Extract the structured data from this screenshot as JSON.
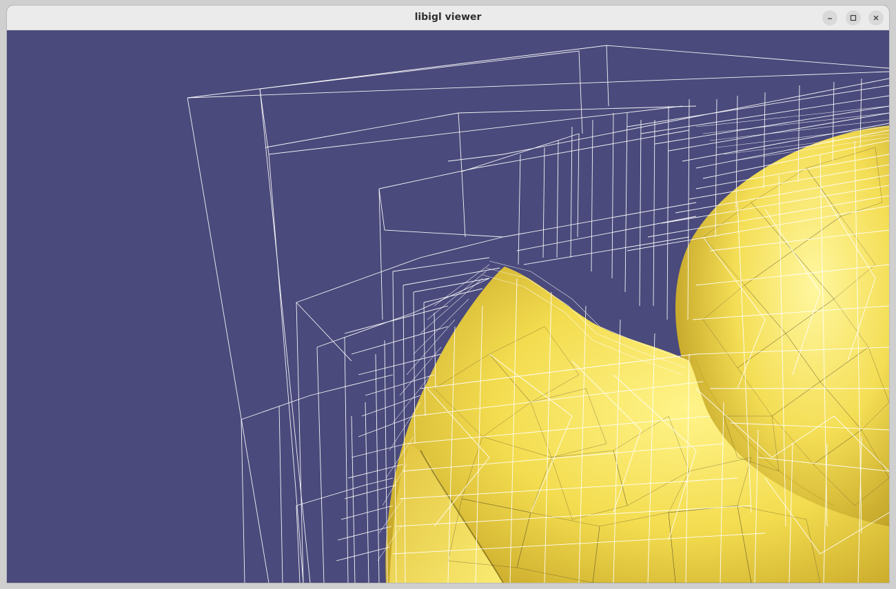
{
  "window": {
    "title": "libigl viewer",
    "buttons": {
      "minimize_icon": "minimize-icon",
      "maximize_icon": "maximize-icon",
      "close_icon": "close-icon"
    }
  },
  "viewport": {
    "background_color": "#4a4a7c",
    "mesh_color": "#f5e05a",
    "wireframe_color": "#ffffff",
    "mesh_edge_color": "#333333"
  }
}
